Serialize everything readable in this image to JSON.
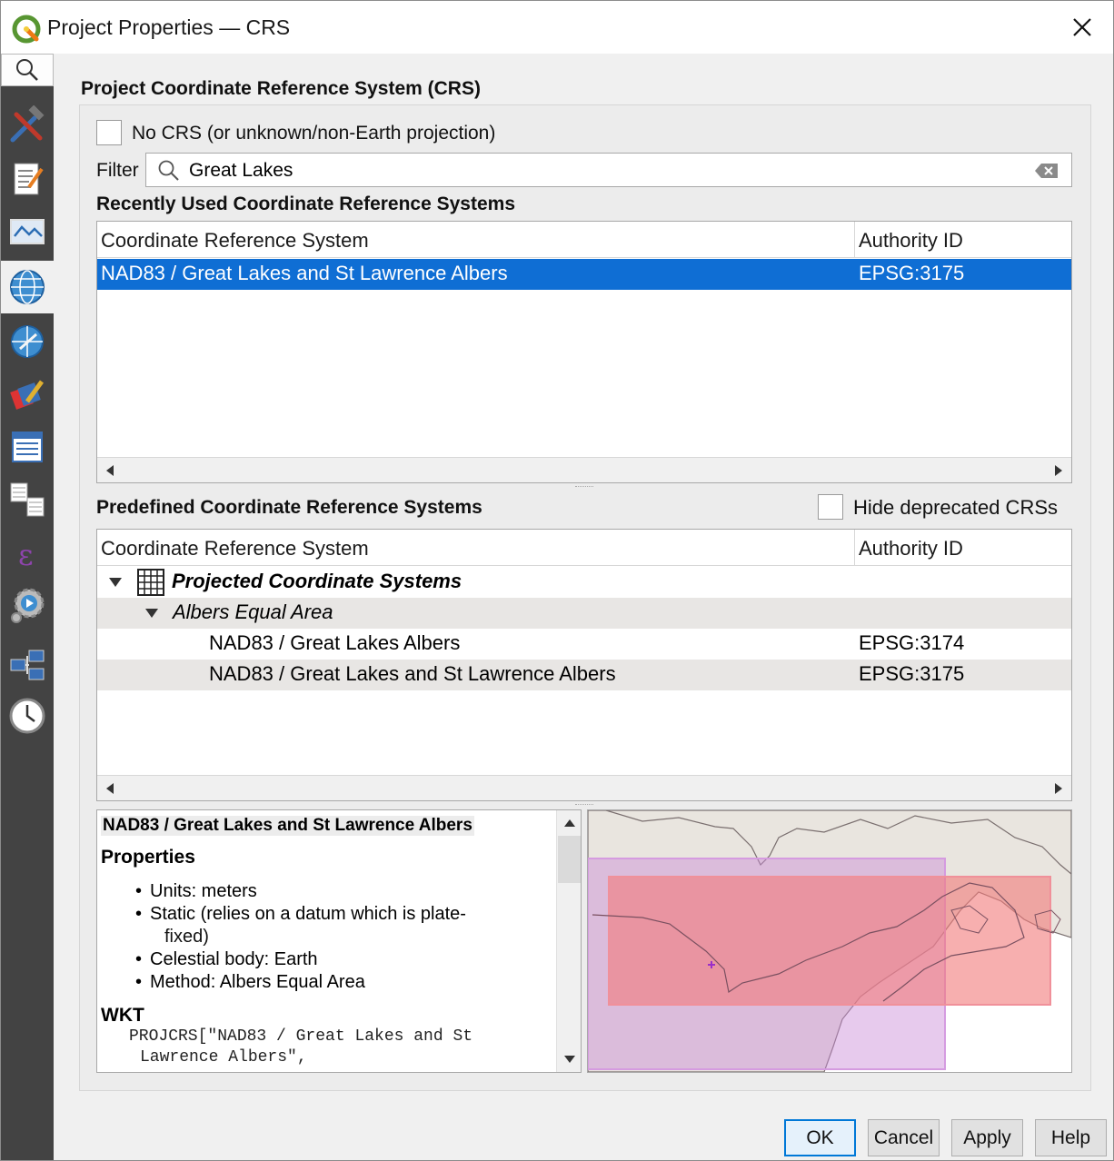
{
  "window": {
    "title": "Project Properties — CRS"
  },
  "sidebar": {
    "items": [
      {
        "icon": "search-icon"
      },
      {
        "icon": "general-tools-icon"
      },
      {
        "icon": "metadata-icon"
      },
      {
        "icon": "view-settings-icon"
      },
      {
        "icon": "crs-globe-icon",
        "active": true
      },
      {
        "icon": "transformations-icon"
      },
      {
        "icon": "default-styles-icon"
      },
      {
        "icon": "data-sources-icon"
      },
      {
        "icon": "relations-icon"
      },
      {
        "icon": "variables-icon"
      },
      {
        "icon": "macros-icon"
      },
      {
        "icon": "qgis-server-icon"
      },
      {
        "icon": "temporal-icon"
      }
    ]
  },
  "crs": {
    "section_title": "Project Coordinate Reference System (CRS)",
    "no_crs_label": "No CRS (or unknown/non-Earth projection)",
    "no_crs_checked": false,
    "filter_label": "Filter",
    "filter_value": "Great Lakes",
    "recent": {
      "title": "Recently Used Coordinate Reference Systems",
      "columns": [
        "Coordinate Reference System",
        "Authority ID"
      ],
      "rows": [
        {
          "name": "NAD83 / Great Lakes and St Lawrence Albers",
          "id": "EPSG:3175",
          "selected": true
        }
      ]
    },
    "predefined": {
      "title": "Predefined Coordinate Reference Systems",
      "hide_deprecated_label": "Hide deprecated CRSs",
      "hide_deprecated_checked": false,
      "columns": [
        "Coordinate Reference System",
        "Authority ID"
      ],
      "group": "Projected Coordinate Systems",
      "subgroup": "Albers Equal Area",
      "rows": [
        {
          "name": "NAD83 / Great Lakes Albers",
          "id": "EPSG:3174"
        },
        {
          "name": "NAD83 / Great Lakes and St Lawrence Albers",
          "id": "EPSG:3175"
        }
      ]
    },
    "details": {
      "title": "NAD83 / Great Lakes and St Lawrence Albers",
      "properties_heading": "Properties",
      "bullets": [
        "Units: meters",
        "Static (relies on a datum which is plate-",
        "Celestial body: Earth",
        "Method: Albers Equal Area"
      ],
      "bullet_continuation": "fixed)",
      "wkt_heading": "WKT",
      "wkt_line1": "PROJCRS[\"NAD83 / Great Lakes and St",
      "wkt_line2": "Lawrence Albers\","
    }
  },
  "buttons": {
    "ok": "OK",
    "cancel": "Cancel",
    "apply": "Apply",
    "help": "Help"
  },
  "colors": {
    "selection": "#0f6ed4",
    "sidebar": "#434343",
    "extent_pink": "#f08080",
    "extent_violet": "#d08ad8"
  }
}
